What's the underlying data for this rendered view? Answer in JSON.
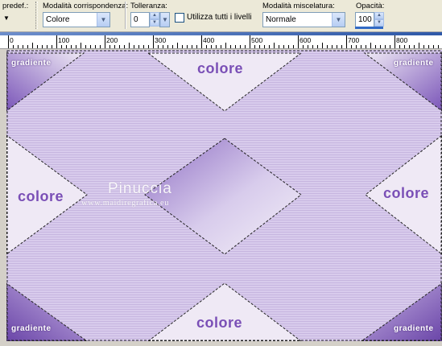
{
  "toolbar": {
    "preset_label": "predef.:",
    "match_mode_label": "Modalità corrispondenza:",
    "match_mode_value": "Colore",
    "tolerance_label": "Tolleranza:",
    "tolerance_value": "0",
    "use_all_layers_label": "Utilizza tutti i livelli",
    "use_all_layers_checked": false,
    "blend_mode_label": "Modalità miscelatura:",
    "blend_mode_value": "Normale",
    "opacity_label": "Opacità:",
    "opacity_value": "100"
  },
  "ruler": {
    "labels": [
      "0",
      "100",
      "200",
      "300",
      "400",
      "500",
      "600",
      "700",
      "800"
    ]
  },
  "canvas": {
    "labels": {
      "colore_top": "colore",
      "colore_left": "colore",
      "colore_right": "colore",
      "colore_bottom": "colore",
      "gradiente_tl": "gradiente",
      "gradiente_tr": "gradiente",
      "gradiente_bl": "gradiente",
      "gradiente_br": "gradiente"
    },
    "watermark": {
      "name": "Pinuccia",
      "url": "www.maidiregrafica.eu"
    }
  },
  "colors": {
    "stripe_light": "#d8cbec",
    "stripe_dark": "#c7b6e0",
    "colore_fill": "#efe9f5",
    "gradient_dark": "#7a55b8",
    "label_purple": "#7a4fb6"
  }
}
